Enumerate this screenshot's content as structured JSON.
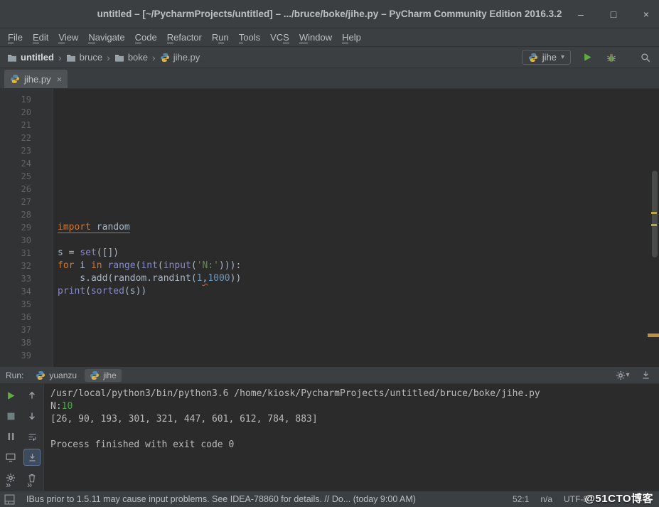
{
  "titlebar": {
    "title": "untitled – [~/PycharmProjects/untitled] – .../bruce/boke/jihe.py – PyCharm Community Edition 2016.3.2",
    "minimize_glyph": "–",
    "maximize_glyph": "□",
    "close_glyph": "×"
  },
  "menubar": {
    "items": [
      {
        "label": "File",
        "mnemonic": 0
      },
      {
        "label": "Edit",
        "mnemonic": 0
      },
      {
        "label": "View",
        "mnemonic": 0
      },
      {
        "label": "Navigate",
        "mnemonic": 0
      },
      {
        "label": "Code",
        "mnemonic": 0
      },
      {
        "label": "Refactor",
        "mnemonic": 0
      },
      {
        "label": "Run",
        "mnemonic": 1
      },
      {
        "label": "Tools",
        "mnemonic": 0
      },
      {
        "label": "VCS",
        "mnemonic": 2
      },
      {
        "label": "Window",
        "mnemonic": 0
      },
      {
        "label": "Help",
        "mnemonic": 0
      }
    ]
  },
  "navbar": {
    "separator": "›",
    "dropdown_glyph": "▾",
    "breadcrumbs": [
      {
        "label": "untitled",
        "icon": "folder",
        "bold": true
      },
      {
        "label": "bruce",
        "icon": "folder",
        "bold": false
      },
      {
        "label": "boke",
        "icon": "folder",
        "bold": false
      },
      {
        "label": "jihe.py",
        "icon": "python",
        "bold": false
      }
    ],
    "run_config": "jihe"
  },
  "editor": {
    "tab_label": "jihe.py",
    "tab_close_glyph": "×",
    "lines": [
      {
        "n": 19,
        "tk": []
      },
      {
        "n": 20,
        "tk": []
      },
      {
        "n": 21,
        "tk": []
      },
      {
        "n": 22,
        "tk": []
      },
      {
        "n": 23,
        "tk": []
      },
      {
        "n": 24,
        "tk": []
      },
      {
        "n": 25,
        "tk": []
      },
      {
        "n": 26,
        "tk": []
      },
      {
        "n": 27,
        "tk": []
      },
      {
        "n": 28,
        "tk": []
      },
      {
        "n": 29,
        "tk": [
          {
            "t": "import",
            "c": "kw",
            "u": true
          },
          {
            "t": " ",
            "c": "plain",
            "u": true
          },
          {
            "t": "random",
            "c": "plain",
            "u": true
          }
        ]
      },
      {
        "n": 30,
        "tk": []
      },
      {
        "n": 31,
        "tk": [
          {
            "t": "s = ",
            "c": "plain"
          },
          {
            "t": "set",
            "c": "builtin"
          },
          {
            "t": "([])",
            "c": "plain"
          }
        ]
      },
      {
        "n": 32,
        "tk": [
          {
            "t": "for",
            "c": "kw"
          },
          {
            "t": " i ",
            "c": "plain"
          },
          {
            "t": "in",
            "c": "kw"
          },
          {
            "t": " ",
            "c": "plain"
          },
          {
            "t": "range",
            "c": "builtin"
          },
          {
            "t": "(",
            "c": "plain"
          },
          {
            "t": "int",
            "c": "builtin"
          },
          {
            "t": "(",
            "c": "plain"
          },
          {
            "t": "input",
            "c": "builtin"
          },
          {
            "t": "(",
            "c": "plain"
          },
          {
            "t": "'N:'",
            "c": "str"
          },
          {
            "t": "))):",
            "c": "plain"
          }
        ]
      },
      {
        "n": 33,
        "tk": [
          {
            "t": "    s.add(random.randint(",
            "c": "plain"
          },
          {
            "t": "1",
            "c": "num"
          },
          {
            "t": ",",
            "c": "plain",
            "w": true
          },
          {
            "t": "1000",
            "c": "num"
          },
          {
            "t": "))",
            "c": "plain"
          }
        ]
      },
      {
        "n": 34,
        "tk": [
          {
            "t": "print",
            "c": "builtin"
          },
          {
            "t": "(",
            "c": "plain"
          },
          {
            "t": "sorted",
            "c": "builtin"
          },
          {
            "t": "(s))",
            "c": "plain"
          }
        ]
      },
      {
        "n": 35,
        "tk": []
      },
      {
        "n": 36,
        "tk": []
      },
      {
        "n": 37,
        "tk": []
      },
      {
        "n": 38,
        "tk": []
      },
      {
        "n": 39,
        "tk": []
      }
    ]
  },
  "run_panel": {
    "label": "Run:",
    "tabs": [
      {
        "label": "yuanzu",
        "selected": false
      },
      {
        "label": "jihe",
        "selected": true
      }
    ],
    "toolbar_left": [
      {
        "name": "rerun-button",
        "icon": "play",
        "selected": false
      },
      {
        "name": "stop-button",
        "icon": "stop",
        "selected": false
      },
      {
        "name": "pause-output-button",
        "icon": "pause",
        "selected": false
      },
      {
        "name": "restore-layout-button",
        "icon": "monitor",
        "selected": false
      },
      {
        "name": "settings-button",
        "icon": "gear",
        "selected": false
      }
    ],
    "toolbar_console": [
      {
        "name": "up-stack-trace-button",
        "icon": "up",
        "selected": false
      },
      {
        "name": "down-stack-trace-button",
        "icon": "down",
        "selected": false
      },
      {
        "name": "soft-wrap-button",
        "icon": "softwrap",
        "selected": false
      },
      {
        "name": "scroll-to-end-button",
        "icon": "scrollend",
        "selected": true
      },
      {
        "name": "clear-all-button",
        "icon": "trash",
        "selected": false
      }
    ],
    "more_glyph": "»",
    "console": [
      [
        {
          "t": "/usr/local/python3/bin/python3.6 /home/kiosk/PycharmProjects/untitled/bruce/boke/jihe.py",
          "c": "stdout"
        }
      ],
      [
        {
          "t": "N:",
          "c": "stdout"
        },
        {
          "t": "10",
          "c": "stdin"
        }
      ],
      [
        {
          "t": "[26, 90, 193, 301, 321, 447, 601, 612, 784, 883]",
          "c": "stdout"
        }
      ],
      [],
      [
        {
          "t": "Process finished with exit code 0",
          "c": "stdout"
        }
      ]
    ]
  },
  "statusbar": {
    "message": "IBus prior to 1.5.11 may cause input problems. See IDEA-78860 for details. // Do... (today 9:00 AM)",
    "caret": "52:1",
    "lock": "n/a",
    "encoding": "UTF-8"
  },
  "watermark": {
    "text": "@51CTO博客"
  },
  "colors": {
    "panel_bg": "#3c3f41",
    "editor_bg": "#2b2b2b",
    "keyword": "#cc7832",
    "string": "#6a8759",
    "number": "#6897bb",
    "builtin": "#8888c6",
    "stdin_green": "#4ca64c",
    "run_green": "#54a857"
  }
}
